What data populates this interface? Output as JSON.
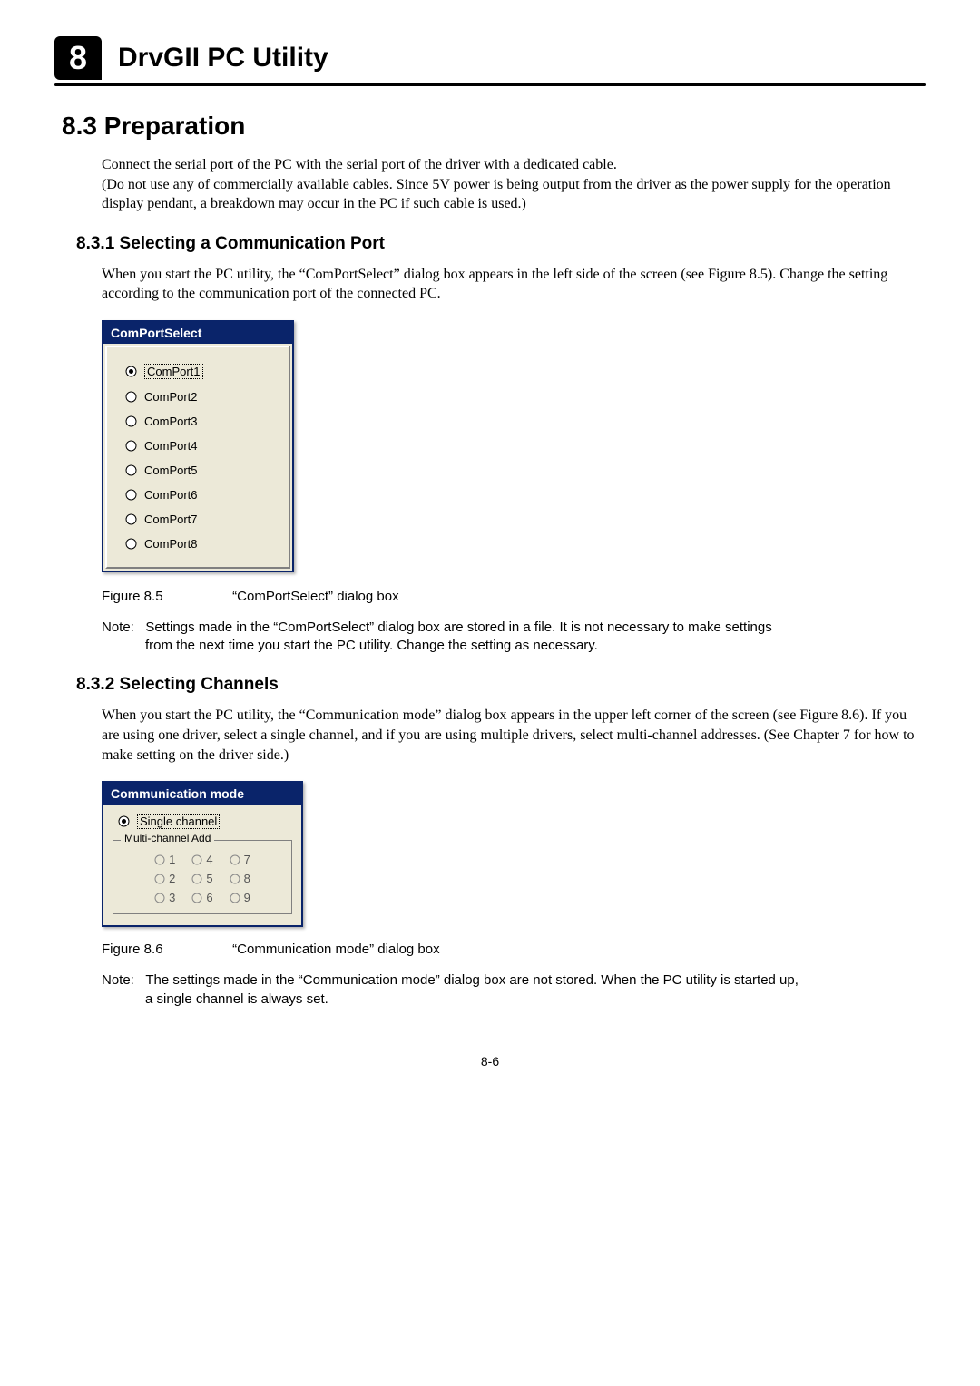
{
  "header": {
    "chapter_num": "8",
    "chapter_title": "DrvGII PC Utility"
  },
  "section83": {
    "heading": "8.3    Preparation",
    "para1_line1": "Connect the serial port of the PC with the serial port of the driver with a dedicated cable.",
    "para1_line2": "(Do not use any of commercially available cables. Since 5V power is being output from the driver as the power supply for the operation display pendant, a breakdown may occur in the PC if such cable is used.)"
  },
  "section831": {
    "heading": "8.3.1    Selecting a Communication Port",
    "para": "When you start the PC utility, the “ComPortSelect” dialog box appears in the left side of the screen (see Figure 8.5). Change the setting according to the communication port of the connected PC.",
    "dialog": {
      "title": "ComPortSelect",
      "options": [
        "ComPort1",
        "ComPort2",
        "ComPort3",
        "ComPort4",
        "ComPort5",
        "ComPort6",
        "ComPort7",
        "ComPort8"
      ]
    },
    "figure_num": "Figure 8.5",
    "figure_caption": "“ComPortSelect” dialog box",
    "note_label": "Note:",
    "note_text_1": "Settings made in the “ComPortSelect” dialog box are stored in a file. It is not necessary to make settings",
    "note_text_2": "from the next time you start the PC utility. Change the setting as necessary."
  },
  "section832": {
    "heading": "8.3.2    Selecting Channels",
    "para": "When you start the PC utility, the “Communication mode” dialog box appears in the upper left corner of the screen (see Figure 8.6). If you are using one driver, select a single channel, and if you are using multiple drivers, select multi-channel addresses. (See Chapter 7 for how to make setting on the driver side.)",
    "dialog": {
      "title": "Communication mode",
      "single_label": "Single channel",
      "group_title": "Multi-channel Add",
      "opts": [
        "1",
        "4",
        "7",
        "2",
        "5",
        "8",
        "3",
        "6",
        "9"
      ]
    },
    "figure_num": "Figure 8.6",
    "figure_caption": "“Communication mode” dialog box",
    "note_label": "Note:",
    "note_text_1": "The settings made in the “Communication mode” dialog box are not stored. When the PC utility is started up,",
    "note_text_2": "a single channel is always set."
  },
  "footer": {
    "page_number": "8-6"
  }
}
